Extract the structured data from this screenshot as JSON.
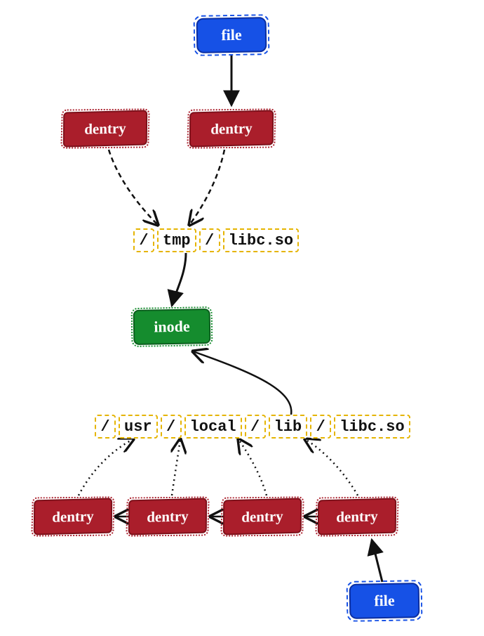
{
  "nodes": {
    "file_top": {
      "label": "file"
    },
    "dentry_t1": {
      "label": "dentry"
    },
    "dentry_t2": {
      "label": "dentry"
    },
    "inode": {
      "label": "inode"
    },
    "dentry_b1": {
      "label": "dentry"
    },
    "dentry_b2": {
      "label": "dentry"
    },
    "dentry_b3": {
      "label": "dentry"
    },
    "dentry_b4": {
      "label": "dentry"
    },
    "file_bottom": {
      "label": "file"
    }
  },
  "paths": {
    "top": {
      "segments": [
        "/",
        "tmp",
        "/",
        "libc.so"
      ]
    },
    "bottom": {
      "segments": [
        "/",
        "usr",
        "/",
        "local",
        "/",
        "lib",
        "/",
        "libc.so"
      ]
    }
  },
  "colors": {
    "file": "#1651e6",
    "dentry": "#aa1e2b",
    "inode": "#158c2e",
    "pathBorder": "#e5b400",
    "ink": "#111111"
  },
  "edges": [
    {
      "from": "file_top",
      "to": "dentry_t2",
      "style": "solid"
    },
    {
      "from": "dentry_t1",
      "to": "path_top",
      "style": "dashed"
    },
    {
      "from": "dentry_t2",
      "to": "path_top",
      "style": "dashed"
    },
    {
      "from": "path_top",
      "to": "inode",
      "style": "solid"
    },
    {
      "from": "path_bottom",
      "to": "inode",
      "style": "solid"
    },
    {
      "from": "dentry_b1",
      "to": "path_bottom",
      "style": "dotted"
    },
    {
      "from": "dentry_b2",
      "to": "path_bottom",
      "style": "dotted"
    },
    {
      "from": "dentry_b3",
      "to": "path_bottom",
      "style": "dotted"
    },
    {
      "from": "dentry_b4",
      "to": "path_bottom",
      "style": "dotted"
    },
    {
      "from": "dentry_b2",
      "to": "dentry_b1",
      "style": "solid"
    },
    {
      "from": "dentry_b3",
      "to": "dentry_b2",
      "style": "solid"
    },
    {
      "from": "dentry_b4",
      "to": "dentry_b3",
      "style": "solid"
    },
    {
      "from": "file_bottom",
      "to": "dentry_b4",
      "style": "solid"
    }
  ]
}
